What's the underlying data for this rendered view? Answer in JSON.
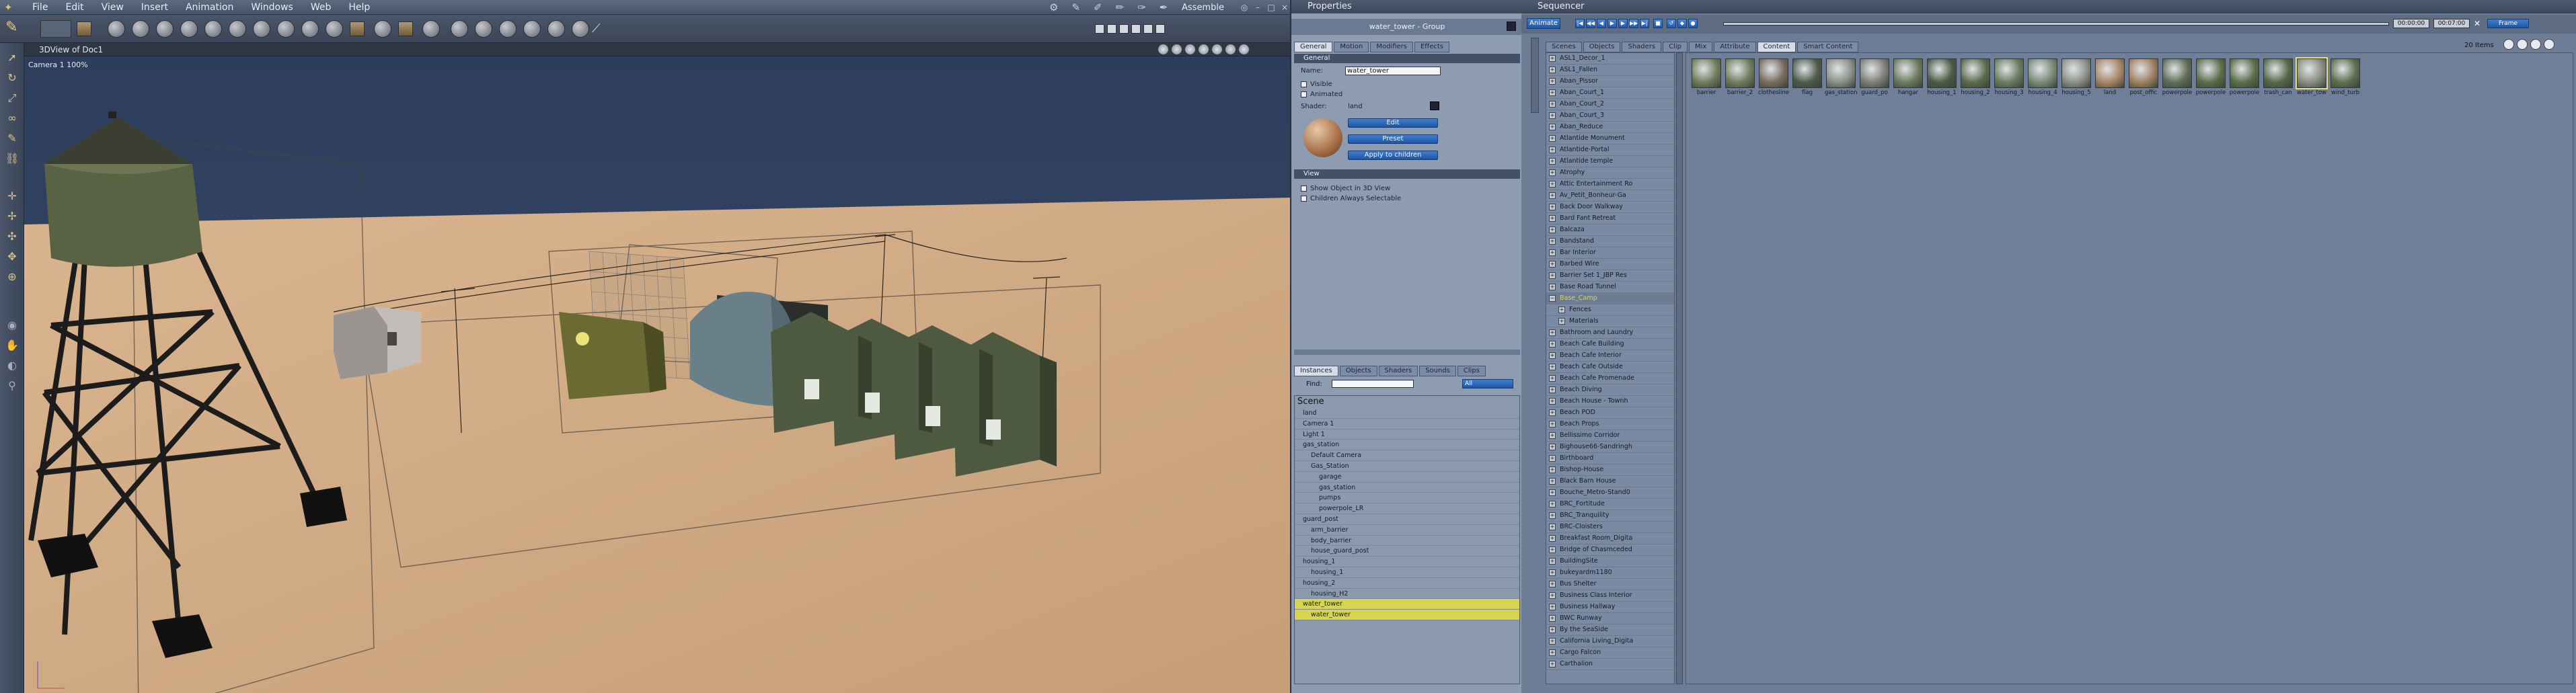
{
  "app": {
    "menus": [
      "File",
      "Edit",
      "View",
      "Insert",
      "Animation",
      "Windows",
      "Web",
      "Help"
    ],
    "room": "Assemble",
    "window_buttons": [
      "◎",
      "–",
      "□",
      "×"
    ]
  },
  "viewport": {
    "title": "3DView of Doc1",
    "camera_label": "Camera 1 100%"
  },
  "properties": {
    "title": "Properties",
    "object_label": "water_tower - Group",
    "tabs": [
      "General",
      "Motion",
      "Modifiers",
      "Effects"
    ],
    "general_header": "General",
    "name_label": "Name:",
    "name_value": "water_tower",
    "visible_label": "Visible",
    "animated_label": "Animated",
    "shader_label": "Shader:",
    "shader_value": "land",
    "edit_button": "Edit",
    "preset_button": "Preset",
    "apply_button": "Apply to children",
    "view_header": "View",
    "show_object_label": "Show Object in 3D View",
    "children_selectable_label": "Children Always Selectable"
  },
  "instances": {
    "tabs": [
      "Instances",
      "Objects",
      "Shaders",
      "Sounds",
      "Clips"
    ],
    "find_label": "Find:",
    "find_filter": "All",
    "scene_label": "Scene",
    "rows": [
      {
        "label": "land",
        "indent": 1,
        "selected": false
      },
      {
        "label": "Camera 1",
        "indent": 1,
        "selected": false
      },
      {
        "label": "Light 1",
        "indent": 1,
        "selected": false
      },
      {
        "label": "gas_station",
        "indent": 1,
        "selected": false
      },
      {
        "label": "Default Camera",
        "indent": 2,
        "selected": false
      },
      {
        "label": "Gas_Station",
        "indent": 2,
        "selected": false
      },
      {
        "label": "garage",
        "indent": 3,
        "selected": false
      },
      {
        "label": "gas_station",
        "indent": 3,
        "selected": false
      },
      {
        "label": "pumps",
        "indent": 3,
        "selected": false
      },
      {
        "label": "powerpole_LR",
        "indent": 3,
        "selected": false
      },
      {
        "label": "guard_post",
        "indent": 1,
        "selected": false
      },
      {
        "label": "arm_barrier",
        "indent": 2,
        "selected": false
      },
      {
        "label": "body_barrier",
        "indent": 2,
        "selected": false
      },
      {
        "label": "house_guard_post",
        "indent": 2,
        "selected": false
      },
      {
        "label": "housing_1",
        "indent": 1,
        "selected": false
      },
      {
        "label": "housing_1",
        "indent": 2,
        "selected": false
      },
      {
        "label": "housing_2",
        "indent": 1,
        "selected": false
      },
      {
        "label": "housing_H2",
        "indent": 2,
        "selected": false
      },
      {
        "label": "water_tower",
        "indent": 1,
        "selected": true
      },
      {
        "label": "water_tower",
        "indent": 2,
        "selected": true
      }
    ]
  },
  "sequencer": {
    "title": "Sequencer",
    "animate_button": "Animate",
    "time_start": "00:00:00",
    "time_end": "00:07:00",
    "frame_button": "Frame",
    "tabs": [
      "Scenes",
      "Objects",
      "Shaders",
      "Clip",
      "Mix",
      "Attribute",
      "Content",
      "Smart Content"
    ],
    "items_count": "20 Items",
    "tree": [
      {
        "label": "ASL1_Decor_1",
        "open": false
      },
      {
        "label": "ASL1_Fallen",
        "open": false
      },
      {
        "label": "Aban_Pissor",
        "open": false
      },
      {
        "label": "Aban_Court_1",
        "open": false
      },
      {
        "label": "Aban_Court_2",
        "open": false
      },
      {
        "label": "Aban_Court_3",
        "open": false
      },
      {
        "label": "Aban_Reduce",
        "open": false
      },
      {
        "label": "Atlantide Monument",
        "open": false
      },
      {
        "label": "Atlantide-Portal",
        "open": false
      },
      {
        "label": "Atlantide temple",
        "open": false
      },
      {
        "label": "Atrophy",
        "open": false
      },
      {
        "label": "Attic Entertainment Ro",
        "open": false
      },
      {
        "label": "Av_Petit_Bonheur-Ga",
        "open": false
      },
      {
        "label": "Back Door Walkway",
        "open": false
      },
      {
        "label": "Bard Fant Retreat",
        "open": false
      },
      {
        "label": "Balcaza",
        "open": false
      },
      {
        "label": "Bandstand",
        "open": false
      },
      {
        "label": "Bar Interior",
        "open": false
      },
      {
        "label": "Barbed Wire",
        "open": false
      },
      {
        "label": "Barrier Set 1_JBP Res",
        "open": false
      },
      {
        "label": "Base Road Tunnel",
        "open": false
      },
      {
        "label": "Base_Camp",
        "open": true
      },
      {
        "label": "Fences",
        "open": false,
        "child": true
      },
      {
        "label": "Materials",
        "open": false,
        "child": true
      },
      {
        "label": "Bathroom and Laundry",
        "open": false
      },
      {
        "label": "Beach Cafe Building",
        "open": false
      },
      {
        "label": "Beach Cafe Interior",
        "open": false
      },
      {
        "label": "Beach Cafe Outside",
        "open": false
      },
      {
        "label": "Beach Cafe Promenade",
        "open": false
      },
      {
        "label": "Beach Diving",
        "open": false
      },
      {
        "label": "Beach House - Townh",
        "open": false
      },
      {
        "label": "Beach POD",
        "open": false
      },
      {
        "label": "Beach Props",
        "open": false
      },
      {
        "label": "Bellissimo Corridor",
        "open": false
      },
      {
        "label": "Bighouse66-Sandringh",
        "open": false
      },
      {
        "label": "Birthboard",
        "open": false
      },
      {
        "label": "Bishop-House",
        "open": false
      },
      {
        "label": "Black Barn House",
        "open": false
      },
      {
        "label": "Bouche_Metro-Stand0",
        "open": false
      },
      {
        "label": "BRC_Fortitude",
        "open": false
      },
      {
        "label": "BRC_Tranquility",
        "open": false
      },
      {
        "label": "BRC-Cloisters",
        "open": false
      },
      {
        "label": "Breakfast Room_Digita",
        "open": false
      },
      {
        "label": "Bridge of Chasmceded",
        "open": false
      },
      {
        "label": "BuildingSite",
        "open": false
      },
      {
        "label": "bukeyardm1180",
        "open": false
      },
      {
        "label": "Bus Shelter",
        "open": false
      },
      {
        "label": "Business Class Interior",
        "open": false
      },
      {
        "label": "Business Hallway",
        "open": false
      },
      {
        "label": "BWC Runway",
        "open": false
      },
      {
        "label": "By the SeaSide",
        "open": false
      },
      {
        "label": "California Living_Digita",
        "open": false
      },
      {
        "label": "Cargo Falcon",
        "open": false
      },
      {
        "label": "Carthalion",
        "open": false
      }
    ],
    "thumbs": [
      {
        "label": "barrier",
        "color": "#6f7c5a"
      },
      {
        "label": "barrier_2",
        "color": "#6f7c5a"
      },
      {
        "label": "clothesline",
        "color": "#7a6a5e"
      },
      {
        "label": "flag",
        "color": "#4e5a48"
      },
      {
        "label": "gas_station",
        "color": "#8b8f86"
      },
      {
        "label": "guard_po",
        "color": "#7d7e78"
      },
      {
        "label": "hangar",
        "color": "#6b7a5c"
      },
      {
        "label": "housing_1",
        "color": "#4c5943"
      },
      {
        "label": "housing_2",
        "color": "#5c6a4c"
      },
      {
        "label": "housing_3",
        "color": "#6a7b60"
      },
      {
        "label": "housing_4",
        "color": "#7b8a76"
      },
      {
        "label": "housing_5",
        "color": "#8c8f88"
      },
      {
        "label": "land",
        "color": "#a78564"
      },
      {
        "label": "post_offic",
        "color": "#9f7f5f"
      },
      {
        "label": "powerpole",
        "color": "#5f6c56"
      },
      {
        "label": "powerpole",
        "color": "#5a6d48"
      },
      {
        "label": "powerpole",
        "color": "#5a6d48"
      },
      {
        "label": "trash_can",
        "color": "#556848"
      },
      {
        "label": "water_tow",
        "color": "#8a8d82"
      },
      {
        "label": "wind_turb",
        "color": "#5d6d4e"
      }
    ],
    "selected_thumb": 18
  }
}
